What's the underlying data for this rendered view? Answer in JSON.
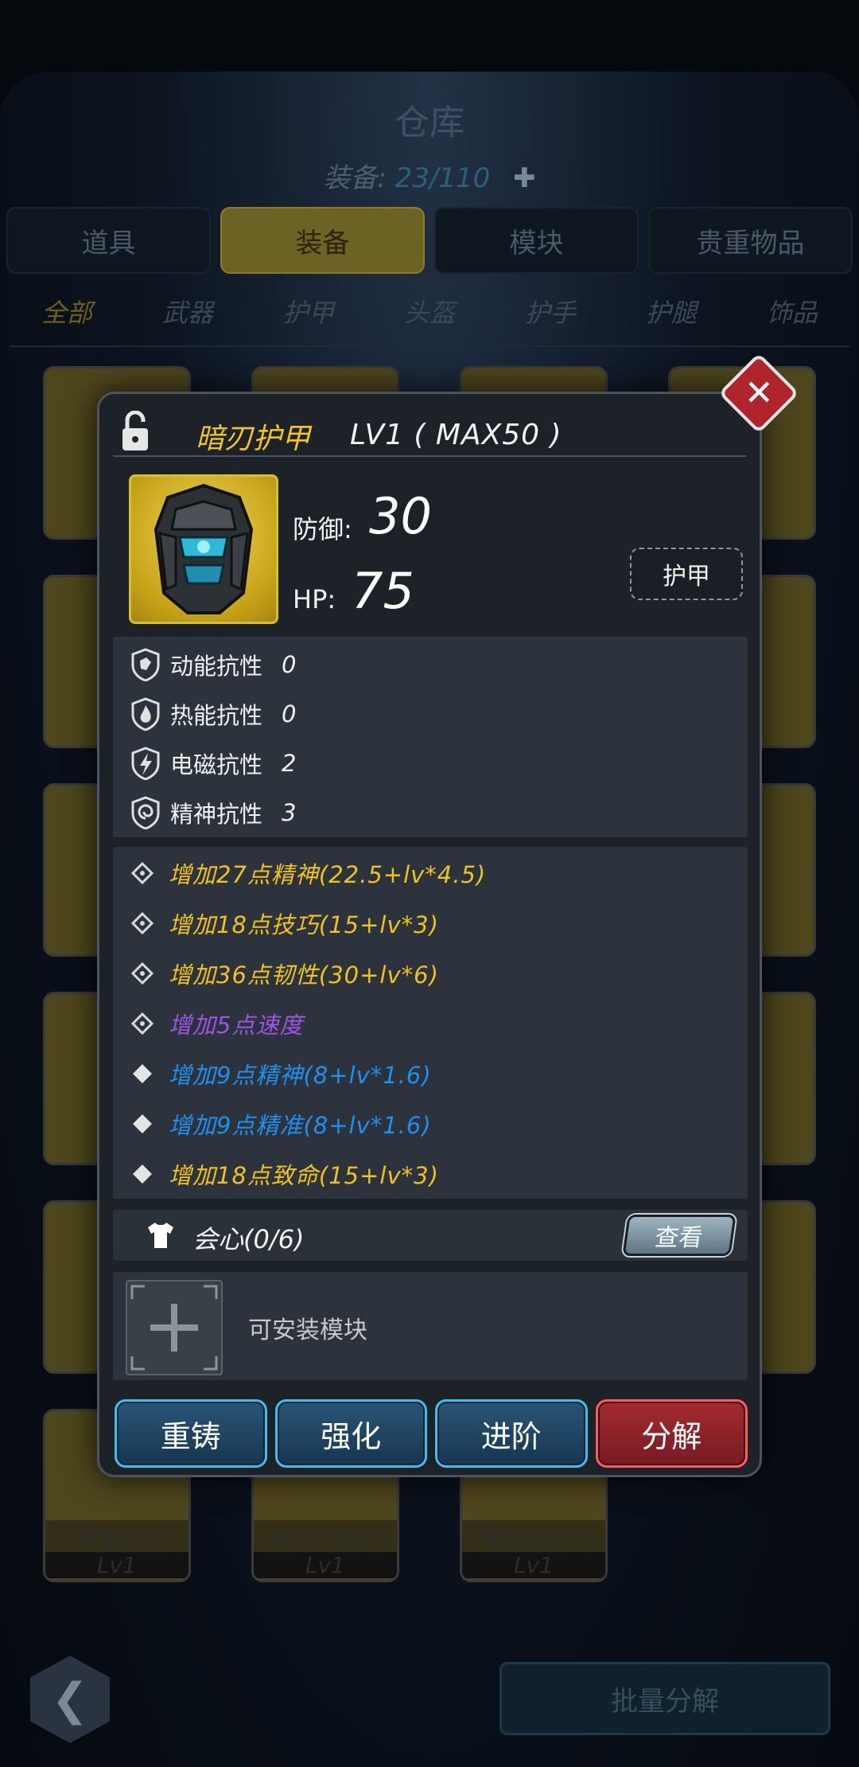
{
  "warehouse": {
    "title": "仓库",
    "count_label": "装备:",
    "count_value": "23/110",
    "tabs": [
      "道具",
      "装备",
      "模块",
      "贵重物品"
    ],
    "active_tab": "装备",
    "subtabs": [
      "全部",
      "武器",
      "护甲",
      "头盔",
      "护手",
      "护腿",
      "饰品"
    ],
    "active_subtab": "全部",
    "bottom_cards": [
      {
        "name": "冠军之证",
        "level": "Lv1"
      },
      {
        "name": "角斗士钩爪",
        "level": "Lv1"
      },
      {
        "name": "角斗士钩爪",
        "level": "Lv1"
      }
    ],
    "batch_button": "批量分解"
  },
  "item": {
    "name": "暗刃护甲",
    "level": "LV1 ( MAX50 )",
    "defense_label": "防御:",
    "defense_value": "30",
    "hp_label": "HP:",
    "hp_value": "75",
    "type": "护甲"
  },
  "resistances": [
    {
      "label": "动能抗性",
      "value": "0"
    },
    {
      "label": "热能抗性",
      "value": "0"
    },
    {
      "label": "电磁抗性",
      "value": "2"
    },
    {
      "label": "精神抗性",
      "value": "3"
    }
  ],
  "attributes": [
    {
      "text": "增加27点精神(22.5+lv*4.5)",
      "color": "#f0c21e"
    },
    {
      "text": "增加18点技巧(15+lv*3)",
      "color": "#f0c21e"
    },
    {
      "text": "增加36点韧性(30+lv*6)",
      "color": "#f0c21e"
    },
    {
      "text": "增加5点速度",
      "color": "#9b55e6"
    },
    {
      "text": "增加9点精神(8+lv*1.6)",
      "color": "#1f8ff0"
    },
    {
      "text": "增加9点精准(8+lv*1.6)",
      "color": "#1f8ff0"
    },
    {
      "text": "增加18点致命(15+lv*3)",
      "color": "#f0c21e"
    }
  ],
  "set": {
    "label": "会心(0/6)",
    "view_button": "查看"
  },
  "module": {
    "text": "可安装模块"
  },
  "actions": {
    "recast": "重铸",
    "enhance": "强化",
    "advance": "进阶",
    "dismantle": "分解"
  }
}
